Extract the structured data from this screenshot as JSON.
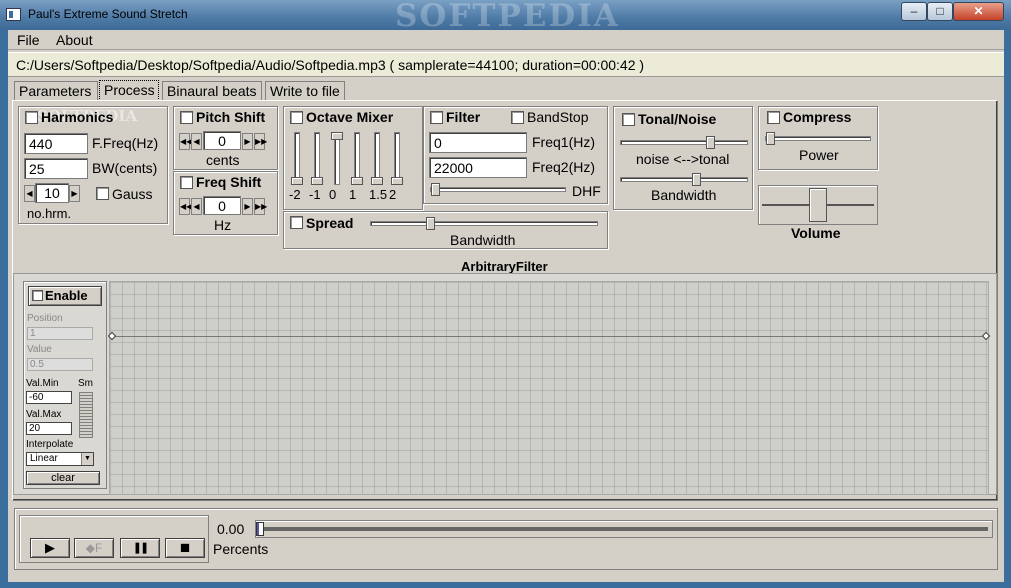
{
  "window": {
    "title": "Paul's Extreme Sound Stretch",
    "watermark": "SOFTPEDIA",
    "min_glyph": "–",
    "max_glyph": "□",
    "close_glyph": "✕"
  },
  "menu": {
    "file": "File",
    "about": "About"
  },
  "file_info": "C:/Users/Softpedia/Desktop/Softpedia/Audio/Softpedia.mp3 ( samplerate=44100; duration=00:00:42 )",
  "tabs": [
    "Parameters",
    "Process",
    "Binaural beats",
    "Write to file"
  ],
  "active_tab": "Process",
  "harmonics": {
    "title": "Harmonics",
    "freq_value": "440",
    "freq_label": "F.Freq(Hz)",
    "bw_value": "25",
    "bw_label": "BW(cents)",
    "num_value": "10",
    "num_label": "no.hrm.",
    "gauss_label": "Gauss",
    "watermark": "SOFTPEDIA"
  },
  "pitch_shift": {
    "title": "Pitch Shift",
    "value": "0",
    "unit": "cents"
  },
  "freq_shift": {
    "title": "Freq Shift",
    "value": "0",
    "unit": "Hz"
  },
  "octave_mixer": {
    "title": "Octave Mixer",
    "labels": [
      "-2",
      "-1",
      "0",
      "1",
      "1.5",
      "2"
    ],
    "levels": [
      0,
      0,
      1,
      0,
      0,
      0
    ]
  },
  "spread": {
    "title": "Spread",
    "label": "Bandwidth",
    "level": 0.25
  },
  "filter": {
    "title": "Filter",
    "bandstop_label": "BandStop",
    "freq1_value": "0",
    "freq1_label": "Freq1(Hz)",
    "freq2_value": "22000",
    "freq2_label": "Freq2(Hz)",
    "dhf_label": "DHF",
    "dhf_level": 0
  },
  "tonal_noise": {
    "title": "Tonal/Noise",
    "mix_label": "noise <-->tonal",
    "mix_level": 0.72,
    "bw_label": "Bandwidth",
    "bw_level": 0.6
  },
  "compress": {
    "title": "Compress",
    "power_label": "Power",
    "power_level": 0
  },
  "volume": {
    "label": "Volume",
    "level": 0.5
  },
  "arbitrary_filter": {
    "title": "ArbitraryFilter",
    "enable_label": "Enable",
    "position_label": "Position",
    "position_value": "1",
    "value_label": "Value",
    "value_value": "0.5",
    "valmin_label": "Val.Min",
    "valmin_value": "-60",
    "valmax_label": "Val.Max",
    "valmax_value": "20",
    "sm_label": "Sm",
    "interpolate_label": "Interpolate",
    "interpolate_value": "Linear",
    "clear_label": "clear"
  },
  "transport": {
    "play_glyph": "▶",
    "freeze_label": "F",
    "pause_glyph": "❚❚",
    "stop_glyph": "■",
    "position_value": "0.00",
    "position_label": "Percents",
    "position_level": 0
  }
}
